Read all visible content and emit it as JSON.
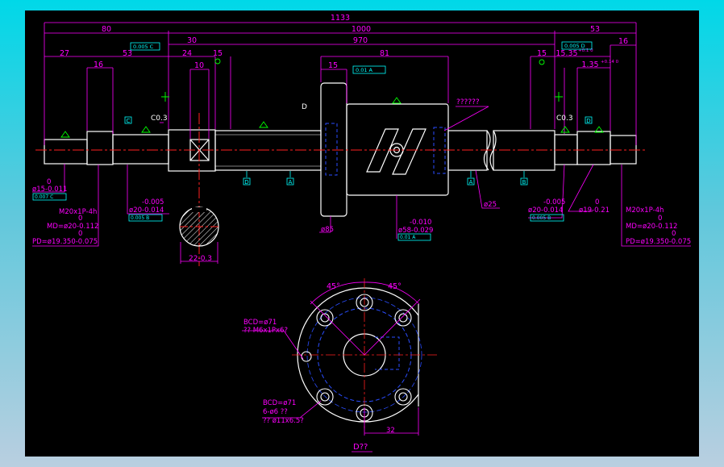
{
  "colors": {
    "background_gradient_top": "#00d8e8",
    "background_gradient_bottom": "#b9cfe0",
    "canvas": "#000000",
    "dimension": "#ff00ff",
    "outline": "#ffffff",
    "centerline": "#ff0000",
    "hidden": "#0000ff",
    "accent": "#00ffff",
    "mark": "#00ff00"
  },
  "dimensions_top": {
    "overall": "1133",
    "left_end": "80",
    "main_length": "1000",
    "right_end": "53",
    "journal": "30",
    "thread_length": "970",
    "left_a": "27",
    "left_b": "53",
    "left_c": "16",
    "mid_a": "24",
    "mid_b": "10",
    "mid_c": "15",
    "nut_a": "15",
    "nut_b": "81",
    "right_a": "15",
    "right_b": "15.35",
    "right_b_tol": "+0.1\n0",
    "right_c": "1.35",
    "right_c_tol": "+0.14\n0",
    "right_d": "16"
  },
  "tolerance_frames": {
    "left": "0.005 C",
    "nut": "0.01 A",
    "right": "0.005 D"
  },
  "labels": {
    "chamfer_left": "C0.3",
    "chamfer_right": "C0.3",
    "unknown_note": "??????",
    "datum_d": "D",
    "datum_c": "C",
    "datum_a": "A",
    "datum_b": "B",
    "datum_d2": "D",
    "section_key": "22-0.3"
  },
  "callouts": {
    "left_dia_val": "0",
    "left_dia": "ø15-0.011",
    "left_dia_frame": "0.007 C",
    "left_thread": "M20x1P-4h",
    "left_md_val": "0",
    "left_md": "MD=ø20-0.112",
    "left_pd_val": "0",
    "left_pd": "PD=ø19.350-0.075",
    "journal_dia_top": "-0.005",
    "journal_dia": "ø20-0.014",
    "journal_frame": "0.005 B",
    "nut_flange_dia": "ø85",
    "nut_dia_top": "-0.010",
    "nut_dia": "ø58-0.029",
    "nut_frame": "0.01 A",
    "shaft_dia": "ø25",
    "right_journal_top": "-0.005",
    "right_journal": "ø20-0.014",
    "right_journal_frame": "0.005 B",
    "right_neck_val": "0",
    "right_neck": "ø19-0.21",
    "right_thread": "M20x1P-4h",
    "right_md_val": "0",
    "right_md": "MD=ø20-0.112",
    "right_pd_val": "0",
    "right_pd": "PD=ø19.350-0.075"
  },
  "end_view": {
    "angle_left": "45°",
    "angle_right": "45°",
    "bcd_note": "BCD=ø71",
    "thread_hole_note": "?? M6x1Px6?",
    "bcd_note_2": "BCD=ø71",
    "holes_note": "6-ø6 ??",
    "cbore_note": "?? ø11x6.5?",
    "flat_width": "32",
    "view_title": "D??"
  }
}
